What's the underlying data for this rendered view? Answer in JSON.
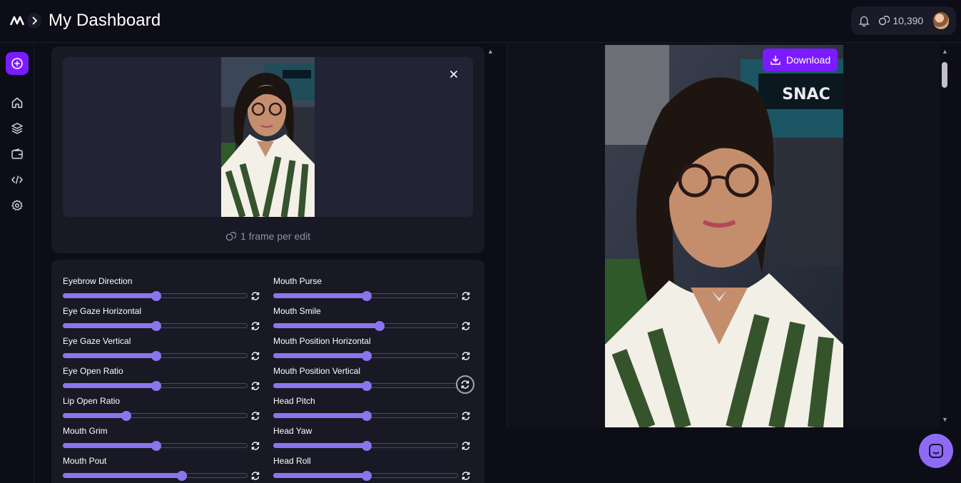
{
  "header": {
    "title": "My Dashboard",
    "credits": "10,390"
  },
  "sidebar": {
    "items": [
      {
        "name": "home-icon"
      },
      {
        "name": "layers-icon"
      },
      {
        "name": "wallet-icon"
      },
      {
        "name": "code-icon"
      },
      {
        "name": "gear-icon"
      }
    ]
  },
  "upload": {
    "frame_note": "1 frame per edit"
  },
  "sliders": {
    "left": [
      {
        "label": "Eyebrow Direction",
        "value": 0.5
      },
      {
        "label": "Eye Gaze Horizontal",
        "value": 0.5
      },
      {
        "label": "Eye Gaze Vertical",
        "value": 0.5
      },
      {
        "label": "Eye Open Ratio",
        "value": 0.5
      },
      {
        "label": "Lip Open Ratio",
        "value": 0.34
      },
      {
        "label": "Mouth Grim",
        "value": 0.5
      },
      {
        "label": "Mouth Pout",
        "value": 0.64
      }
    ],
    "right": [
      {
        "label": "Mouth Purse",
        "value": 0.5
      },
      {
        "label": "Mouth Smile",
        "value": 0.57
      },
      {
        "label": "Mouth Position Horizontal",
        "value": 0.5
      },
      {
        "label": "Mouth Position Vertical",
        "value": 0.5
      },
      {
        "label": "Head Pitch",
        "value": 0.5
      },
      {
        "label": "Head Yaw",
        "value": 0.5
      },
      {
        "label": "Head Roll",
        "value": 0.5
      }
    ]
  },
  "result": {
    "download_label": "Download",
    "overlay_sign": "SNAC"
  },
  "colors": {
    "accent": "#7b1bff",
    "slider": "#8b75ee",
    "background": "#0d0d17",
    "card": "#181925"
  }
}
